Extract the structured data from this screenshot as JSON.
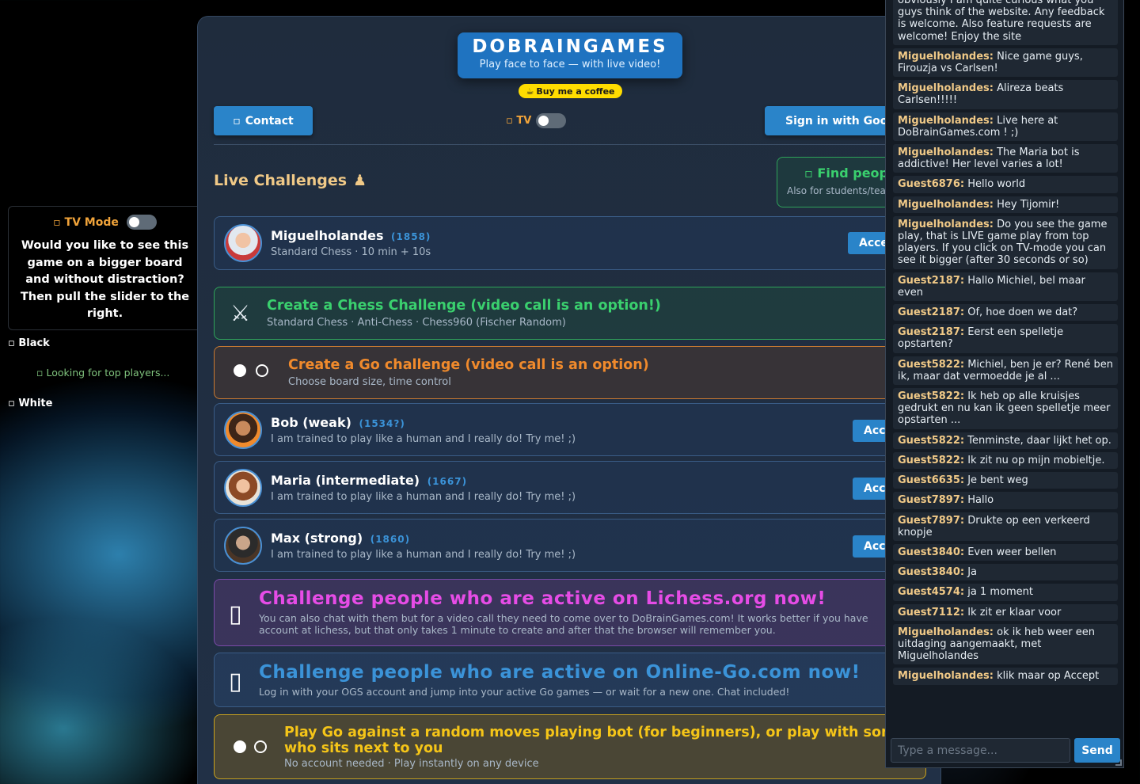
{
  "header": {
    "logo_title": "DOBRAINGAMES",
    "logo_subtitle": "Play face to face — with live video!",
    "coffee_label": "Buy me a coffee",
    "contact_label": "Contact",
    "tv_label": "TV",
    "signin_label": "Sign in with Google"
  },
  "live": {
    "title": "Live Challenges",
    "title_icon": "♟",
    "find_title": "Find people",
    "find_sub": "Also for students/teachers"
  },
  "challenge": {
    "name": "Miguelholandes",
    "rating": "(1858)",
    "details": "Standard Chess  ·  10 min + 10s",
    "accept": "Accept"
  },
  "create_chess": {
    "title": "Create a Chess Challenge (video call is an option!)",
    "sub": "Standard Chess · Anti-Chess · Chess960 (Fischer Random)"
  },
  "create_go": {
    "title": "Create a Go challenge (video call is an option)",
    "sub": "Choose board size, time control"
  },
  "bots": [
    {
      "name": "Bob (weak)",
      "rating": "(1534?)",
      "desc": "I am trained to play like a human and I really do! Try me! ;)",
      "accept": "Accept"
    },
    {
      "name": "Maria (intermediate)",
      "rating": "(1667)",
      "desc": "I am trained to play like a human and I really do! Try me! ;)",
      "accept": "Accept"
    },
    {
      "name": "Max (strong)",
      "rating": "(1860)",
      "desc": "I am trained to play like a human and I really do! Try me! ;)",
      "accept": "Accept"
    }
  ],
  "lichess": {
    "title": "Challenge people who are active on Lichess.org now!",
    "line1": "You can also chat with them but for a video call they need to come over to DoBrainGames.com! It works better if you have",
    "line2": "account at lichess, but that only takes 1 minute to create and after that the browser will remember you."
  },
  "ogs": {
    "title": "Challenge people who are active on Online-Go.com now!",
    "sub": "Log in with your OGS account and jump into your active Go games — or wait for a new one. Chat included!"
  },
  "gobot": {
    "title_line1": "Play Go against a random moves playing bot (for beginners), or play with someone",
    "title_line2": "who sits next to you",
    "sub": "No account needed · Play instantly on any device"
  },
  "tv_panel": {
    "label": "TV Mode",
    "text": "Would you like to see this game on a bigger board and without distraction? Then pull the slider to the right.",
    "black": "Black",
    "white": "White",
    "looking": "Looking for top players..."
  },
  "chat": {
    "messages": [
      {
        "user": "",
        "text": "obviously I am quite curious what you guys think of the website. Any feedback is welcome. Also feature requests are welcome! Enjoy the site"
      },
      {
        "user": "Miguelholandes:",
        "text": "Nice game guys, Firouzja vs Carlsen!"
      },
      {
        "user": "Miguelholandes:",
        "text": "Alireza beats Carlsen!!!!!"
      },
      {
        "user": "Miguelholandes:",
        "text": "Live here at DoBrainGames.com ! ;)"
      },
      {
        "user": "Miguelholandes:",
        "text": "The Maria bot is addictive! Her level varies a lot!"
      },
      {
        "user": "Guest6876:",
        "text": "Hello world"
      },
      {
        "user": "Miguelholandes:",
        "text": "Hey Tijomir!"
      },
      {
        "user": "Miguelholandes:",
        "text": "Do you see the game play, that is LIVE game play from top players. If you click on TV-mode you can see it bigger (after 30 seconds or so)"
      },
      {
        "user": "Guest2187:",
        "text": "Hallo Michiel, bel maar even"
      },
      {
        "user": "Guest2187:",
        "text": "Of, hoe doen we dat?"
      },
      {
        "user": "Guest2187:",
        "text": "Eerst een spelletje opstarten?"
      },
      {
        "user": "Guest5822:",
        "text": "Michiel, ben je er? René ben ik, maar dat vermoedde je al ..."
      },
      {
        "user": "Guest5822:",
        "text": "Ik heb op alle kruisjes gedrukt en nu kan ik geen spelletje meer opstarten ..."
      },
      {
        "user": "Guest5822:",
        "text": "Tenminste, daar lijkt het op."
      },
      {
        "user": "Guest5822:",
        "text": "Ik zit nu op mijn mobieltje."
      },
      {
        "user": "Guest6635:",
        "text": "Je bent weg"
      },
      {
        "user": "Guest7897:",
        "text": "Hallo"
      },
      {
        "user": "Guest7897:",
        "text": "Drukte op een verkeerd knopje"
      },
      {
        "user": "Guest3840:",
        "text": "Even weer bellen"
      },
      {
        "user": "Guest3840:",
        "text": "Ja"
      },
      {
        "user": "Guest4574:",
        "text": "ja 1 moment"
      },
      {
        "user": "Guest7112:",
        "text": "Ik zit er klaar voor"
      },
      {
        "user": "Miguelholandes:",
        "text": "ok ik heb weer een uitdaging aangemaakt, met Miguelholandes"
      },
      {
        "user": "Miguelholandes:",
        "text": "klik maar op Accept"
      }
    ],
    "placeholder": "Type a message...",
    "send": "Send"
  }
}
